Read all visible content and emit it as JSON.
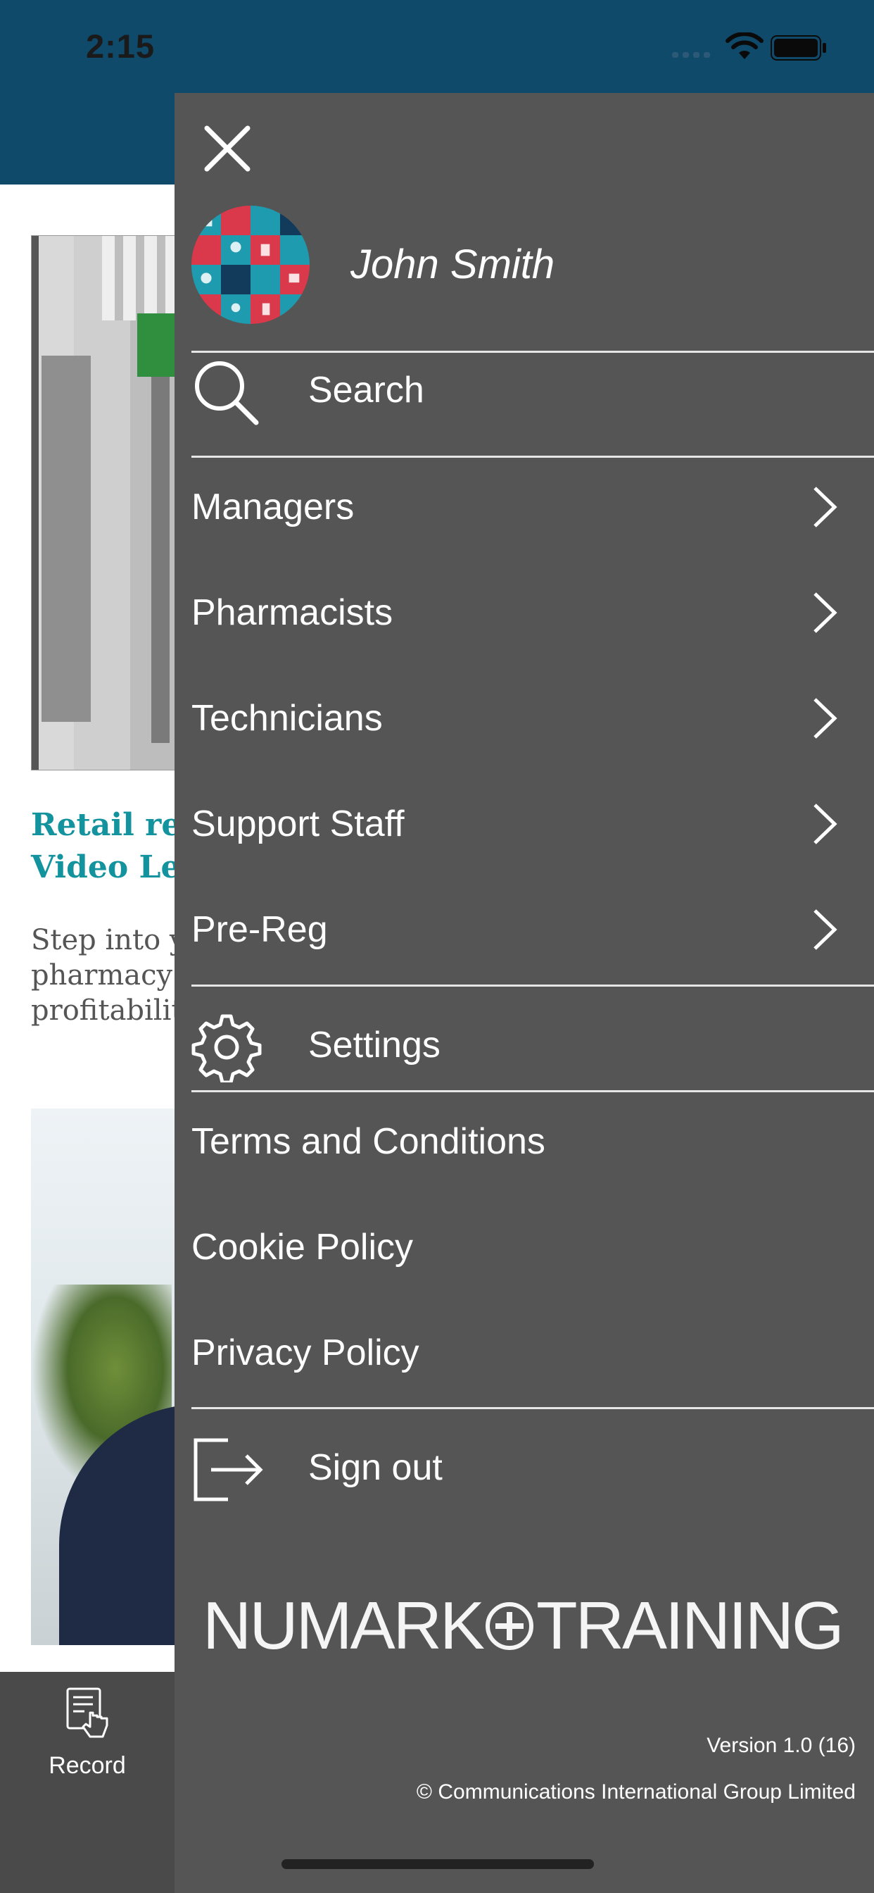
{
  "status_bar": {
    "time": "2:15"
  },
  "background": {
    "card1": {
      "title": "Retail rea\nVideo Le",
      "description": "Step into y\npharmacy\nprofitabilit"
    },
    "tabbar": {
      "record_label": "Record",
      "record_icon": "record-document-icon"
    }
  },
  "drawer": {
    "close_icon": "close-icon",
    "user": {
      "name": "John Smith",
      "avatar_icon": "avatar-icon"
    },
    "search": {
      "label": "Search",
      "icon": "search-icon"
    },
    "menu_items": [
      {
        "label": "Managers"
      },
      {
        "label": "Pharmacists"
      },
      {
        "label": "Technicians"
      },
      {
        "label": "Support Staff"
      },
      {
        "label": "Pre-Reg"
      }
    ],
    "settings": {
      "label": "Settings",
      "icon": "gear-icon"
    },
    "links": [
      {
        "label": "Terms and Conditions"
      },
      {
        "label": "Cookie Policy"
      },
      {
        "label": "Privacy Policy"
      }
    ],
    "sign_out": {
      "label": "Sign out",
      "icon": "sign-out-icon"
    },
    "brand": {
      "left": "NUMARK",
      "right": "TRAINING"
    },
    "version": "Version 1.0 (16)",
    "copyright": "© Communications International Group Limited"
  },
  "colors": {
    "header": "#0f4a6a",
    "drawer_bg": "#555555",
    "accent_teal": "#13939d",
    "tabbar_bg": "#4a4a4a"
  }
}
